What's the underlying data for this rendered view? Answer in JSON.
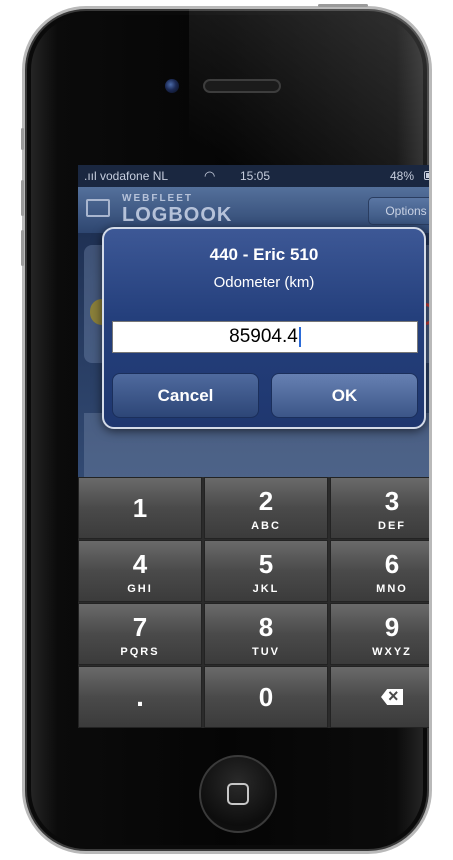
{
  "status_bar": {
    "carrier": ".ııl vodafone NL",
    "time": "15:05",
    "battery": "48%"
  },
  "app": {
    "logo_top": "WEBFLEET",
    "logo_bottom": "LOGBOOK",
    "options_label": "Options"
  },
  "alert": {
    "title": "440 - Eric 510",
    "message": "Odometer (km)",
    "input_value": "85904.4",
    "cancel_label": "Cancel",
    "ok_label": "OK"
  },
  "keypad": {
    "keys": [
      {
        "digit": "1",
        "letters": ""
      },
      {
        "digit": "2",
        "letters": "ABC"
      },
      {
        "digit": "3",
        "letters": "DEF"
      },
      {
        "digit": "4",
        "letters": "GHI"
      },
      {
        "digit": "5",
        "letters": "JKL"
      },
      {
        "digit": "6",
        "letters": "MNO"
      },
      {
        "digit": "7",
        "letters": "PQRS"
      },
      {
        "digit": "8",
        "letters": "TUV"
      },
      {
        "digit": "9",
        "letters": "WXYZ"
      },
      {
        "digit": ".",
        "letters": ""
      },
      {
        "digit": "0",
        "letters": ""
      }
    ]
  },
  "icons": {
    "wifi": "wifi-icon",
    "battery": "battery-icon",
    "backspace": "backspace-icon",
    "home": "home-button-icon"
  }
}
